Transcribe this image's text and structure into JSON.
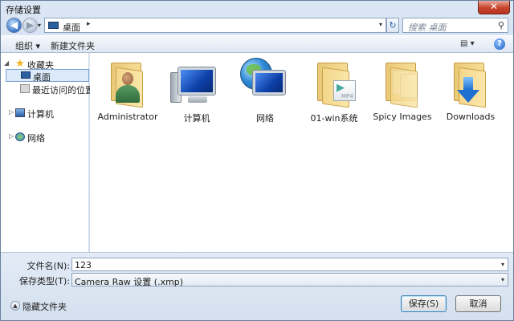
{
  "window": {
    "title": "存储设置",
    "close_glyph": "✕"
  },
  "address_bar": {
    "back_glyph": "◀",
    "forward_glyph": "▶",
    "history_drop": "▾",
    "location": "桌面",
    "separator": "▸",
    "dropdown": "▾",
    "refresh_glyph": "↻"
  },
  "search": {
    "placeholder": "搜索 桌面",
    "icon": "⚲"
  },
  "toolbar": {
    "organize_label": "组织 ▾",
    "new_folder_label": "新建文件夹",
    "view_label": "▤ ▾",
    "help_label": "?"
  },
  "nav_pane": {
    "favorites": {
      "label": "收藏夹",
      "expander": "◢"
    },
    "desktop": {
      "label": "桌面"
    },
    "recent": {
      "label": "最近访问的位置"
    },
    "computer": {
      "label": "计算机",
      "expander": "▷"
    },
    "network": {
      "label": "网络",
      "expander": "▷"
    }
  },
  "items": [
    {
      "label": "Administrator",
      "icon": "user-folder-icon"
    },
    {
      "label": "计算机",
      "icon": "computer-icon"
    },
    {
      "label": "网络",
      "icon": "network-icon"
    },
    {
      "label": "01-win系统",
      "icon": "media-folder-icon",
      "badge": "MP4",
      "play": "▶"
    },
    {
      "label": "Spicy Images",
      "icon": "documents-folder-icon"
    },
    {
      "label": "Downloads",
      "icon": "downloads-folder-icon"
    }
  ],
  "form": {
    "filename_label": "文件名(N):",
    "filename_value": "123",
    "filetype_label": "保存类型(T):",
    "filetype_value": "Camera Raw 设置 (.xmp)",
    "dropdown": "▾"
  },
  "footer": {
    "hide_folders_label": "隐藏文件夹",
    "hide_glyph": "▲",
    "save_label": "保存(S)",
    "cancel_label": "取消"
  },
  "colors": {
    "accent": "#3c7fb1",
    "selection": "#dbe9f9",
    "close_button": "#c7432c",
    "folder": "#f3d68a"
  }
}
